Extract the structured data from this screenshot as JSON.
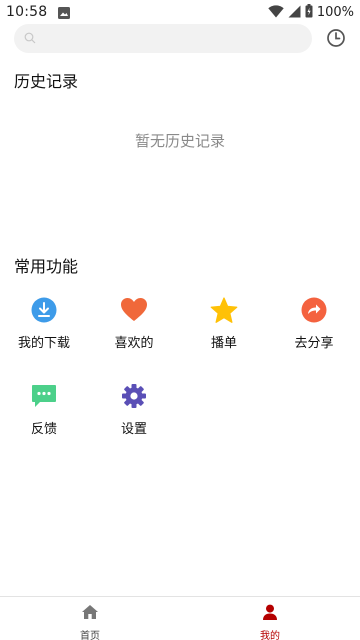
{
  "status_bar": {
    "time": "10:58",
    "battery": "100%"
  },
  "search": {
    "placeholder": "",
    "value": ""
  },
  "history": {
    "title": "历史记录",
    "empty_text": "暂无历史记录"
  },
  "common": {
    "title": "常用功能",
    "items": [
      {
        "label": "我的下载",
        "icon": "download-icon",
        "color": "#3d9be9"
      },
      {
        "label": "喜欢的",
        "icon": "heart-icon",
        "color": "#f0683a"
      },
      {
        "label": "播单",
        "icon": "star-icon",
        "color": "#ffc107"
      },
      {
        "label": "去分享",
        "icon": "share-icon",
        "color": "#f4623f"
      },
      {
        "label": "反馈",
        "icon": "feedback-icon",
        "color": "#4cd08a"
      },
      {
        "label": "设置",
        "icon": "settings-icon",
        "color": "#5a4fb6"
      }
    ]
  },
  "bottom_nav": {
    "items": [
      {
        "label": "首页",
        "icon": "home-icon",
        "active": false,
        "color": "#666666"
      },
      {
        "label": "我的",
        "icon": "user-icon",
        "active": true,
        "color": "#b50000"
      }
    ]
  }
}
